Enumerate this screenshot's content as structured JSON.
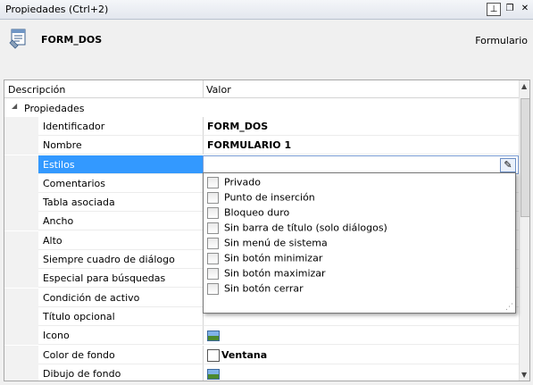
{
  "window": {
    "title": "Propiedades (Ctrl+2)",
    "pin_icon": "pin-icon",
    "restore_icon": "restore-icon",
    "close_icon": "close-icon"
  },
  "header": {
    "object_name": "FORM_DOS",
    "object_type": "Formulario",
    "icon": "form-icon"
  },
  "grid": {
    "col_description": "Descripción",
    "col_value": "Valor",
    "group_label": "Propiedades",
    "rows": [
      {
        "name": "Identificador",
        "value": "FORM_DOS"
      },
      {
        "name": "Nombre",
        "value": "FORMULARIO 1"
      },
      {
        "name": "Estilos",
        "value": ""
      },
      {
        "name": "Comentarios",
        "value": ""
      },
      {
        "name": "Tabla asociada",
        "value": ""
      },
      {
        "name": "Ancho",
        "value": ""
      },
      {
        "name": "Alto",
        "value": ""
      },
      {
        "name": "Siempre cuadro de diálogo",
        "value": ""
      },
      {
        "name": "Especial para búsquedas",
        "value": ""
      },
      {
        "name": "Condición de activo",
        "value": ""
      },
      {
        "name": "Título opcional",
        "value": ""
      },
      {
        "name": "Icono",
        "value": ""
      },
      {
        "name": "Color de fondo",
        "value": "Ventana"
      },
      {
        "name": "Dibujo de fondo",
        "value": ""
      }
    ]
  },
  "styles_dropdown": {
    "options": [
      {
        "label": "Privado",
        "checked": false
      },
      {
        "label": "Punto de inserción",
        "checked": false
      },
      {
        "label": "Bloqueo duro",
        "checked": false
      },
      {
        "label": "Sin barra de título (solo diálogos)",
        "checked": false
      },
      {
        "label": "Sin menú de sistema",
        "checked": false
      },
      {
        "label": "Sin botón minimizar",
        "checked": false
      },
      {
        "label": "Sin botón maximizar",
        "checked": false
      },
      {
        "label": "Sin botón cerrar",
        "checked": false
      }
    ]
  },
  "colors": {
    "selection": "#3399ff",
    "panel_bg": "#f0f0f0"
  }
}
